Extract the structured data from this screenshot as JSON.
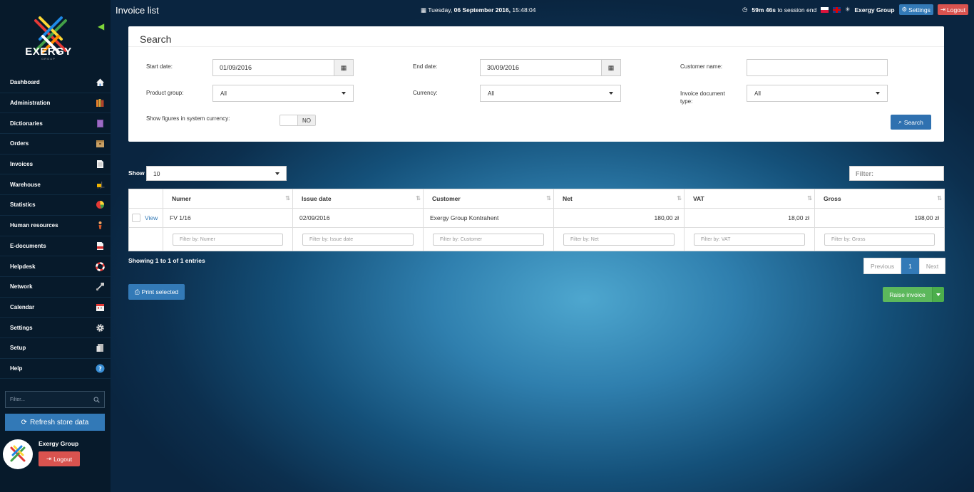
{
  "app": {
    "logo_text": "EXERGY",
    "logo_sub": "GROUP",
    "page_title": "Invoice list",
    "datetime_prefix": "Tuesday,",
    "datetime_date": "06 September 2016,",
    "datetime_time": "15:48:04",
    "session": "59m 46s",
    "session_suffix": "to session end",
    "company": "Exergy Group",
    "settings_label": "Settings",
    "logout_label": "Logout"
  },
  "sidebar": {
    "items": [
      {
        "label": "Dashboard",
        "icon": "home-icon"
      },
      {
        "label": "Administration",
        "icon": "books-icon"
      },
      {
        "label": "Dictionaries",
        "icon": "dictionary-icon"
      },
      {
        "label": "Orders",
        "icon": "box-icon"
      },
      {
        "label": "Invoices",
        "icon": "document-icon"
      },
      {
        "label": "Warehouse",
        "icon": "forklift-icon"
      },
      {
        "label": "Statistics",
        "icon": "pie-chart-icon"
      },
      {
        "label": "Human resources",
        "icon": "person-icon"
      },
      {
        "label": "E-documents",
        "icon": "pdf-icon"
      },
      {
        "label": "Helpdesk",
        "icon": "lifebuoy-icon"
      },
      {
        "label": "Network",
        "icon": "network-icon"
      },
      {
        "label": "Calendar",
        "icon": "calendar-icon"
      },
      {
        "label": "Settings",
        "icon": "gear-icon"
      },
      {
        "label": "Setup",
        "icon": "setup-icon"
      },
      {
        "label": "Help",
        "icon": "help-icon"
      }
    ],
    "filter_placeholder": "Filter...",
    "refresh_label": "Refresh store data",
    "user_name": "Exergy Group",
    "logout_label": "Logout"
  },
  "search": {
    "title": "Search",
    "start_date_label": "Start date:",
    "start_date": "01/09/2016",
    "end_date_label": "End date:",
    "end_date": "30/09/2016",
    "customer_label": "Customer name:",
    "customer_value": "",
    "product_group_label": "Product group:",
    "product_group": "All",
    "currency_label": "Currency:",
    "currency": "All",
    "doc_type_label_1": "Invoice document",
    "doc_type_label_2": "type:",
    "doc_type": "All",
    "system_currency_label": "Show figures in system currency:",
    "toggle_state": "NO",
    "search_button": "Search"
  },
  "table": {
    "show_label": "Show",
    "page_size": "10",
    "filter_placeholder": "Filter:",
    "columns": [
      "Numer",
      "Issue date",
      "Customer",
      "Net",
      "VAT",
      "Gross"
    ],
    "rows": [
      {
        "view": "View",
        "numer": "FV 1/16",
        "issue_date": "02/09/2016",
        "customer": "Exergy Group Kontrahent",
        "net": "180,00 zł",
        "vat": "18,00 zł",
        "gross": "198,00 zł"
      }
    ],
    "column_filters": [
      "Filter by: Numer",
      "Filter by: Issue date",
      "Filter by: Customer",
      "Filter by: Net",
      "Filter by: VAT",
      "Filter by: Gross"
    ],
    "entries_info": "Showing 1 to 1 of 1 entries",
    "prev": "Previous",
    "page": "1",
    "next": "Next",
    "print_label": "Print selected",
    "raise_label": "Raise invoice"
  }
}
